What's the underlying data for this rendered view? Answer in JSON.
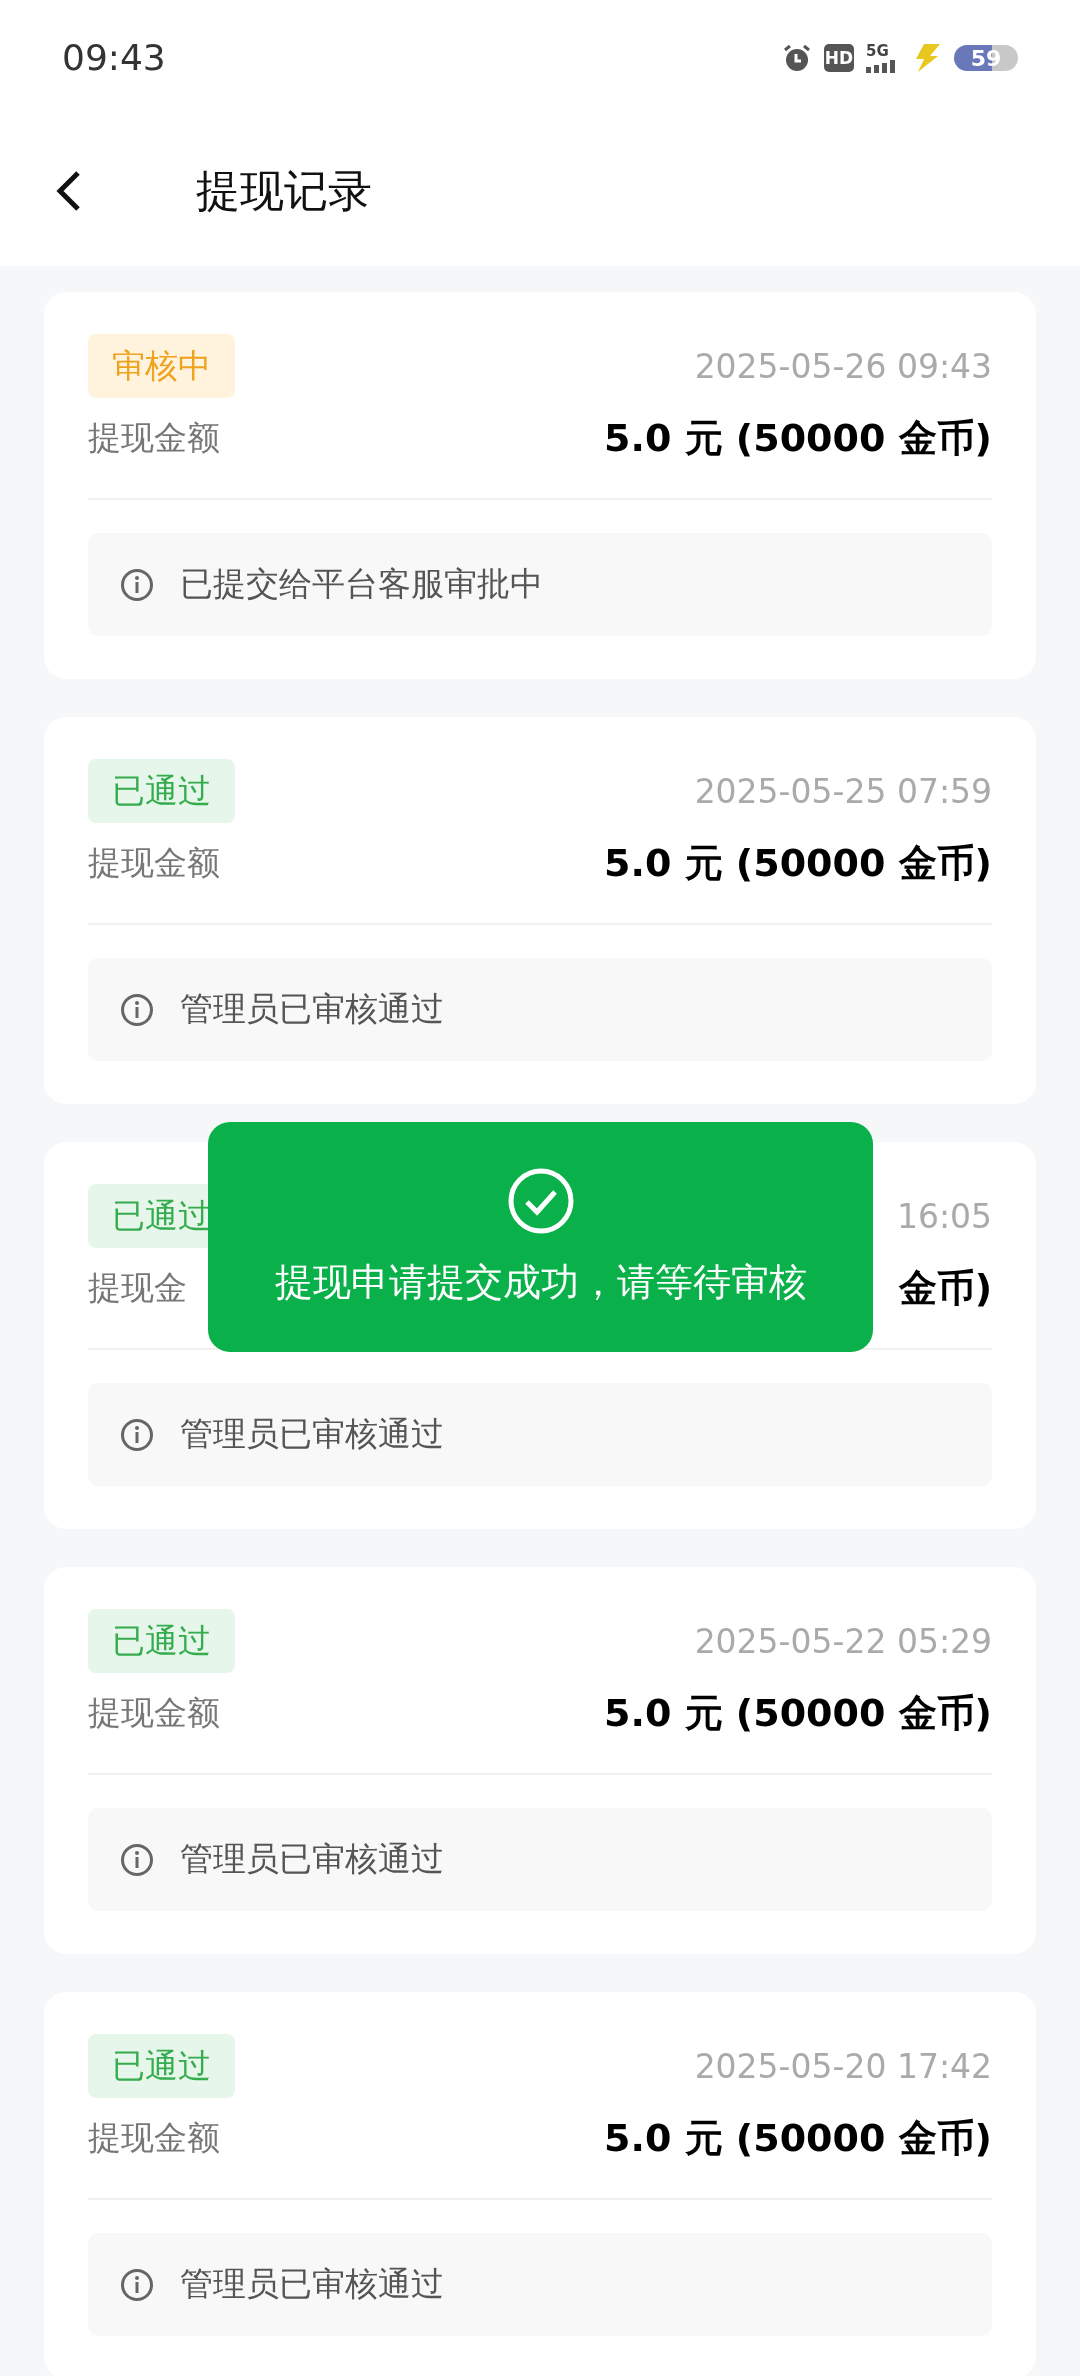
{
  "status_bar": {
    "time": "09:43",
    "network": "5G",
    "battery": "59",
    "hd": "HD"
  },
  "header": {
    "title": "提现记录"
  },
  "records": [
    {
      "kind": "pending",
      "badge": "审核中",
      "date": "2025-05-26 09:43",
      "label": "提现金额",
      "amount": "5.0 元 (50000 金币)",
      "note": "已提交给平台客服审批中"
    },
    {
      "kind": "approved",
      "badge": "已通过",
      "date": "2025-05-25 07:59",
      "label": "提现金额",
      "amount": "5.0 元 (50000 金币)",
      "note": "管理员已审核通过"
    },
    {
      "kind": "approved",
      "badge": "已通过",
      "date": "16:05",
      "label": "提现金",
      "amount": "金币)",
      "note": "管理员已审核通过"
    },
    {
      "kind": "approved",
      "badge": "已通过",
      "date": "2025-05-22 05:29",
      "label": "提现金额",
      "amount": "5.0 元 (50000 金币)",
      "note": "管理员已审核通过"
    },
    {
      "kind": "approved",
      "badge": "已通过",
      "date": "2025-05-20 17:42",
      "label": "提现金额",
      "amount": "5.0 元 (50000 金币)",
      "note": "管理员已审核通过"
    }
  ],
  "toast": {
    "message": "提现申请提交成功，请等待审核"
  }
}
